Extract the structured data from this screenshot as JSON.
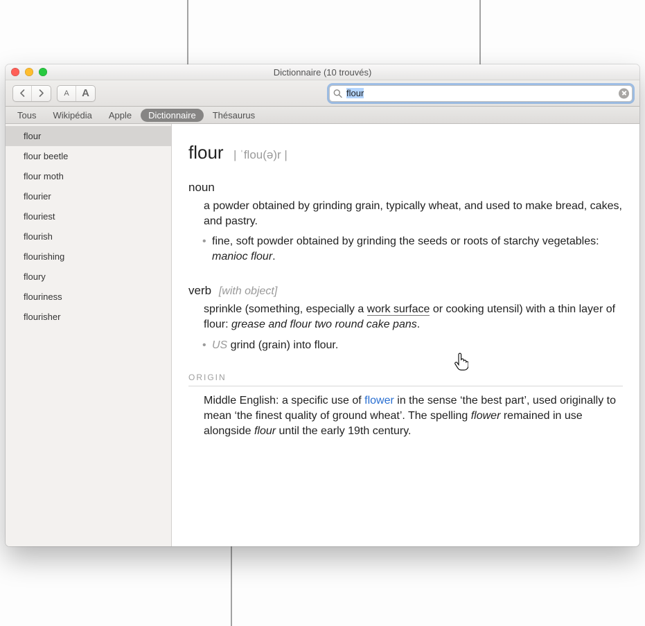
{
  "window": {
    "title": "Dictionnaire (10 trouvés)"
  },
  "search": {
    "value": "flour"
  },
  "tabs": [
    {
      "label": "Tous",
      "active": false
    },
    {
      "label": "Wikipédia",
      "active": false
    },
    {
      "label": "Apple",
      "active": false
    },
    {
      "label": "Dictionnaire",
      "active": true
    },
    {
      "label": "Thésaurus",
      "active": false
    }
  ],
  "sidebar": {
    "items": [
      "flour",
      "flour beetle",
      "flour moth",
      "flourier",
      "flouriest",
      "flourish",
      "flourishing",
      "floury",
      "flouriness",
      "flourisher"
    ],
    "selected_index": 0
  },
  "entry": {
    "headword": "flour",
    "pronunciation": "| ˈflou(ə)r |",
    "noun": {
      "pos": "noun",
      "def": "a powder obtained by grinding grain, typically wheat, and used to make bread, cakes, and pastry.",
      "sub_pre": "fine, soft powder obtained by grinding the seeds or roots of starchy vegetables: ",
      "sub_ex": "manioc flour",
      "sub_post": "."
    },
    "verb": {
      "pos": "verb",
      "gram": "[with object]",
      "def_pre": "sprinkle (something, especially a ",
      "def_link": "work surface",
      "def_mid": " or cooking utensil) with a thin layer of flour: ",
      "def_ex": "grease and flour two round cake pans",
      "def_post": ".",
      "sub_region": "US",
      "sub_text": " grind (grain) into flour."
    },
    "origin": {
      "header": "ORIGIN",
      "t1": "Middle English: a specific use of ",
      "link": "flower",
      "t2": " in the sense ‘the best part’, used originally to mean ‘the finest quality of ground wheat’. The spelling ",
      "i1": "flower",
      "t3": " remained in use alongside ",
      "i2": "flour",
      "t4": " until the early 19th century."
    }
  },
  "toolbar": {
    "font_small": "A",
    "font_large": "A"
  }
}
